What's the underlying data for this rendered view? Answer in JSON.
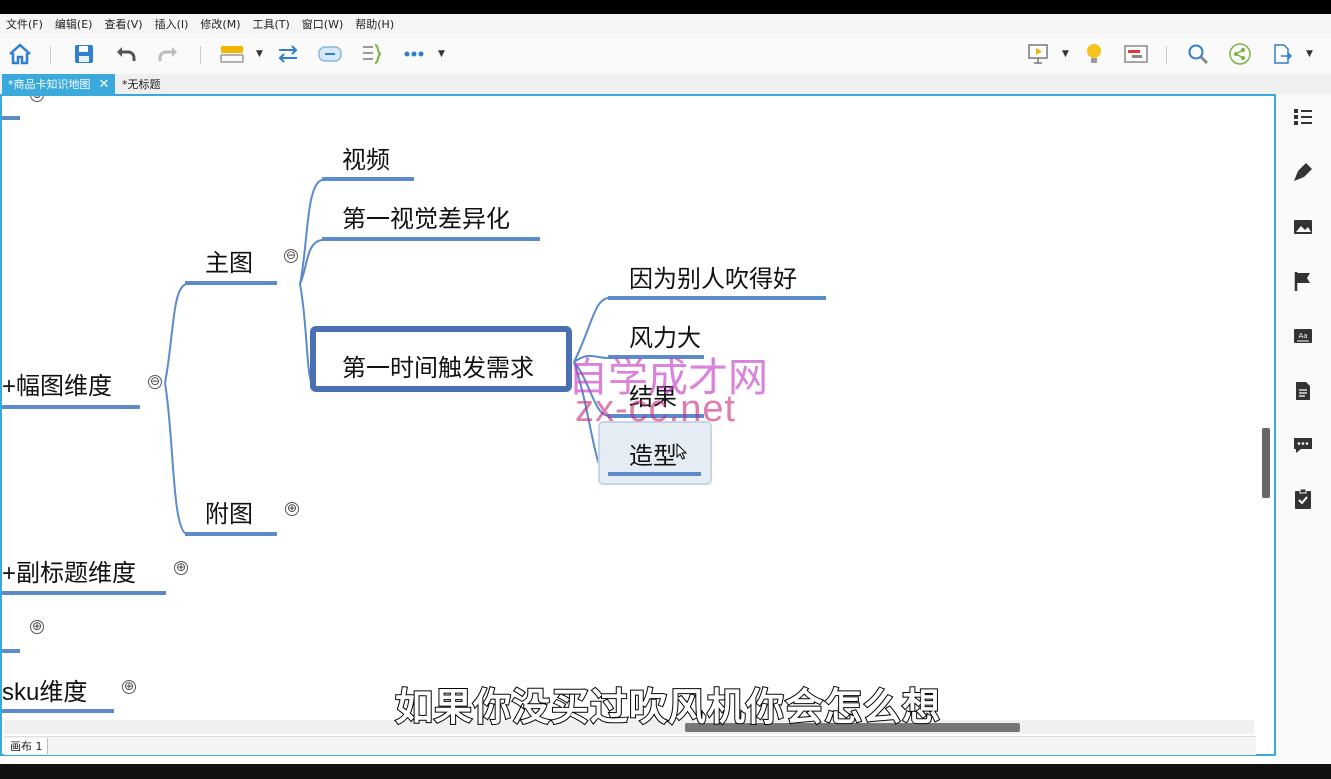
{
  "menu": [
    "文件(F)",
    "编辑(E)",
    "查看(V)",
    "插入(I)",
    "修改(M)",
    "工具(T)",
    "窗口(W)",
    "帮助(H)"
  ],
  "toolbar": {
    "icons": [
      "home-icon",
      "save-icon",
      "undo-icon",
      "redo-icon",
      "topic-icon",
      "relationship-icon",
      "boundary-icon",
      "summary-icon",
      "more-icon",
      "presentation-icon",
      "idea-icon",
      "gantt-icon",
      "search-icon",
      "share-icon",
      "export-icon"
    ]
  },
  "tabs": {
    "active": "*商品卡知识地图",
    "active_close": "✕",
    "other": "*无标题"
  },
  "mindmap": {
    "branch1": "+幅图维度",
    "branch2": "+副标题维度",
    "branch3": "sku维度",
    "main_image": "主图",
    "sub_image": "附图",
    "video": "视频",
    "visual_diff": "第一视觉差异化",
    "trigger": "第一时间触发需求",
    "reason": "因为别人吹得好",
    "wind": "风力大",
    "result": "结果",
    "shape": "造型",
    "collapse_symbol": "⊖",
    "expand_symbol": "⊕"
  },
  "watermark": {
    "line1": "自学成才网",
    "line2": "zx-cc.net"
  },
  "subtitle": "如果你没买过吹风机你会怎么想",
  "sheet": {
    "tab": "画布 1"
  },
  "right_panel": {
    "icons": [
      "outline-icon",
      "format-brush-icon",
      "image-icon",
      "marker-flag-icon",
      "text-style-icon",
      "notes-icon",
      "comment-icon",
      "task-icon"
    ]
  }
}
